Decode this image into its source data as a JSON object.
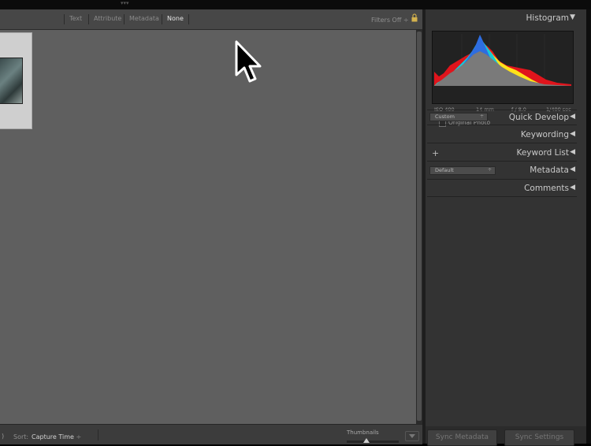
{
  "filter_bar": {
    "items": [
      {
        "label": "Text",
        "active": false
      },
      {
        "label": "Attribute",
        "active": false
      },
      {
        "label": "Metadata",
        "active": false
      },
      {
        "label": "None",
        "active": true
      }
    ],
    "filters_off": "Filters Off"
  },
  "grid": {
    "thumbnail_icon": "photo-thumbnail"
  },
  "toolbar": {
    "sort_label": "Sort:",
    "sort_value": "Capture Time",
    "thumbnails_label": "Thumbnails",
    "thumbnail_size": 0.35
  },
  "right_panel": {
    "histogram": {
      "title": "Histogram",
      "iso": "ISO 400",
      "focal": "14 mm",
      "aperture": "f / 8.0",
      "shutter": "1/400 sec",
      "original_photo": "Original Photo"
    },
    "quick_develop": {
      "title": "Quick Develop",
      "preset": "Custom"
    },
    "keywording": {
      "title": "Keywording"
    },
    "keyword_list": {
      "title": "Keyword List",
      "add": "+"
    },
    "metadata": {
      "title": "Metadata",
      "preset": "Default"
    },
    "comments": {
      "title": "Comments"
    }
  },
  "sync": {
    "metadata": "Sync Metadata",
    "settings": "Sync Settings"
  },
  "colors": {
    "panel": "#333333",
    "grid": "#5f5f5f",
    "histogram_red": "#e0141c",
    "histogram_yellow": "#ffe21a",
    "histogram_cyan": "#18c8d6",
    "histogram_blue": "#2e6de0"
  }
}
